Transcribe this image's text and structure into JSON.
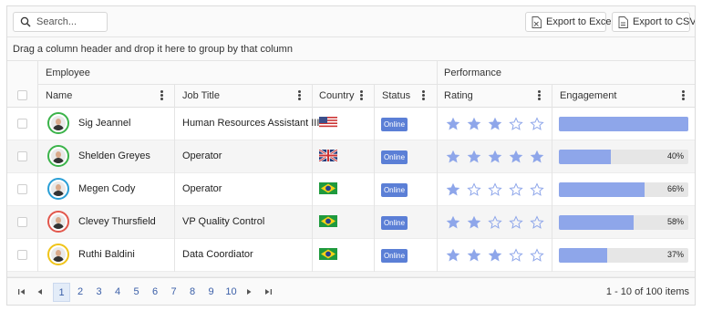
{
  "toolbar": {
    "search_placeholder": "Search...",
    "export_excel_label": "Export to Excel",
    "export_csv_label": "Export to CSV"
  },
  "group_panel_text": "Drag a column header and drop it here to group by that column",
  "column_groups": {
    "employee": "Employee",
    "performance": "Performance"
  },
  "columns": {
    "name": "Name",
    "job_title": "Job Title",
    "country": "Country",
    "status": "Status",
    "rating": "Rating",
    "engagement": "Engagement"
  },
  "colors": {
    "accent": "#5b7fd6",
    "star": "#8ea6ea",
    "engagement_fill": "#8ea6ea"
  },
  "rows": [
    {
      "name": "Sig Jeannel",
      "job_title": "Human Resources Assistant III",
      "country_flag": "us-flag-icon",
      "status": "Online",
      "rating": 3,
      "engagement": 100,
      "engagement_label": "",
      "avatar_ring": "#3bb34a"
    },
    {
      "name": "Shelden Greyes",
      "job_title": "Operator",
      "country_flag": "gb-flag-icon",
      "status": "Online",
      "rating": 5,
      "engagement": 40,
      "engagement_label": "40%",
      "avatar_ring": "#3bb34a"
    },
    {
      "name": "Megen Cody",
      "job_title": "Operator",
      "country_flag": "br-flag-icon",
      "status": "Online",
      "rating": 1,
      "engagement": 66,
      "engagement_label": "66%",
      "avatar_ring": "#2a9fd6"
    },
    {
      "name": "Clevey Thursfield",
      "job_title": "VP Quality Control",
      "country_flag": "br-flag-icon",
      "status": "Online",
      "rating": 2,
      "engagement": 58,
      "engagement_label": "58%",
      "avatar_ring": "#e2574c"
    },
    {
      "name": "Ruthi Baldini",
      "job_title": "Data Coordiator",
      "country_flag": "br-flag-icon",
      "status": "Online",
      "rating": 3,
      "engagement": 37,
      "engagement_label": "37%",
      "avatar_ring": "#f0c419"
    }
  ],
  "pager": {
    "pages": [
      "1",
      "2",
      "3",
      "4",
      "5",
      "6",
      "7",
      "8",
      "9",
      "10"
    ],
    "current_page": "1",
    "info": "1 - 10 of 100 items"
  }
}
